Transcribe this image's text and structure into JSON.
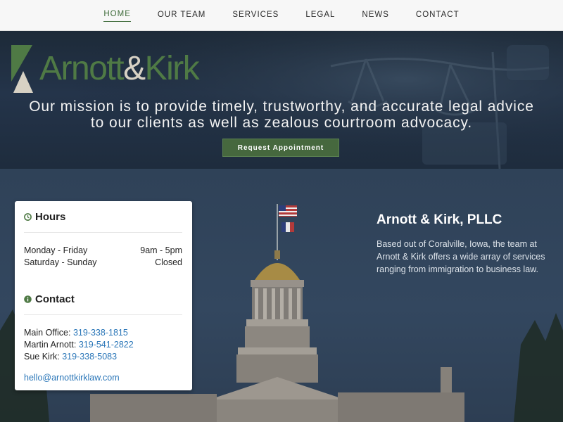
{
  "nav": {
    "items": [
      {
        "label": "HOME",
        "active": true
      },
      {
        "label": "OUR TEAM"
      },
      {
        "label": "SERVICES"
      },
      {
        "label": "LEGAL"
      },
      {
        "label": "NEWS"
      },
      {
        "label": "CONTACT"
      }
    ]
  },
  "hero": {
    "logo": {
      "name_left": "Arnott",
      "ampersand": "&",
      "name_right": "Kirk"
    },
    "mission_line1": "Our mission is to provide timely, trustworthy, and accurate legal advice",
    "mission_line2": "to our clients as well as zealous courtroom advocacy.",
    "cta_label": "Request Appointment"
  },
  "hours": {
    "title": "Hours",
    "rows": [
      {
        "day": "Monday - Friday",
        "time": "9am - 5pm"
      },
      {
        "day": "Saturday - Sunday",
        "time": "Closed"
      }
    ]
  },
  "contact": {
    "title": "Contact",
    "lines": [
      {
        "label": "Main Office:",
        "phone": "319-338-1815"
      },
      {
        "label": "Martin Arnott:",
        "phone": "319-541-2822"
      },
      {
        "label": "Sue Kirk:",
        "phone": "319-338-5083"
      }
    ],
    "email": "hello@arnottkirklaw.com"
  },
  "about": {
    "title": "Arnott & Kirk, PLLC",
    "description": "Based out of Coralville, Iowa, the team at Arnott & Kirk offers a wide array of services ranging from immigration to business law."
  },
  "colors": {
    "brand_green": "#4f7a45",
    "button_green": "#46683e",
    "link_blue": "#2a76b8",
    "hero_bg": "#1e2c3d",
    "main_bg": "#2f4258"
  },
  "icons": {
    "hours": "clock-icon",
    "contact": "info-icon",
    "logo": "logo-triangle-icon"
  }
}
